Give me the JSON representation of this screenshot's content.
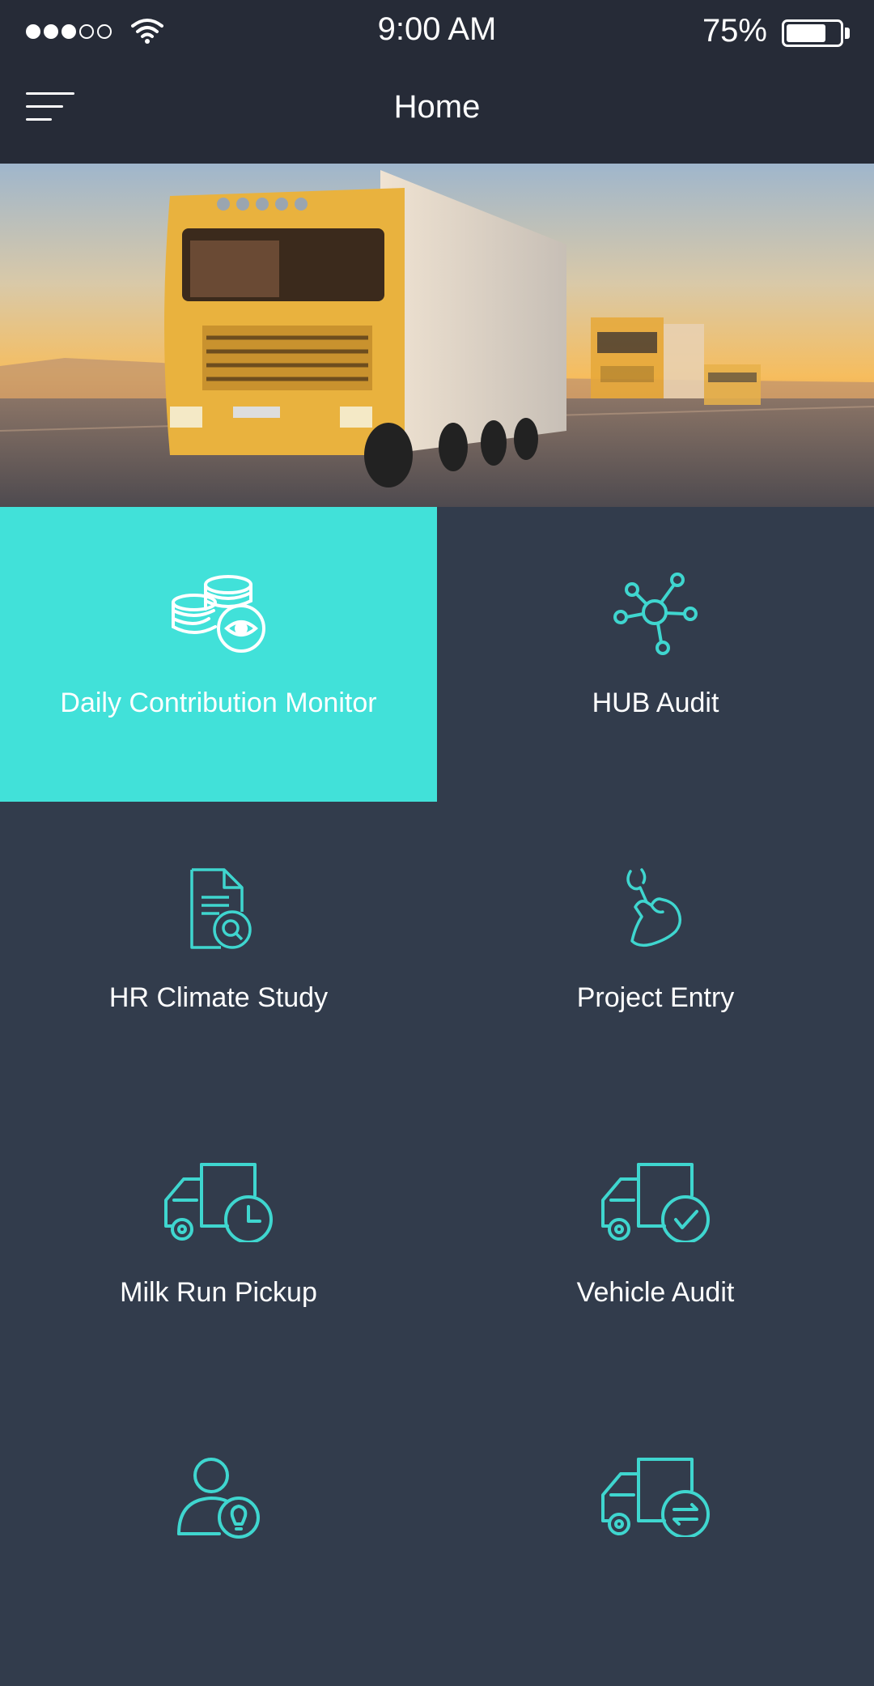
{
  "status_bar": {
    "time": "9:00 AM",
    "battery_percent": "75%",
    "battery_level": 0.75,
    "signal_bars_filled": 3,
    "signal_bars_total": 5
  },
  "header": {
    "title": "Home",
    "menu_icon": "hamburger-menu-icon"
  },
  "banner": {
    "image": "yellow-trucks-on-highway"
  },
  "colors": {
    "accent": "#41e1d9",
    "background": "#323c4c",
    "bar": "#262b37",
    "icon": "#3fd6cf"
  },
  "menu": {
    "items": [
      {
        "label": "Daily Contribution Monitor",
        "icon": "coins-eye-icon",
        "active": true
      },
      {
        "label": "HUB Audit",
        "icon": "network-hub-icon",
        "active": false
      },
      {
        "label": "HR Climate Study",
        "icon": "document-search-icon",
        "active": false
      },
      {
        "label": "Project Entry",
        "icon": "wrench-hand-icon",
        "active": false
      },
      {
        "label": "Milk Run Pickup",
        "icon": "truck-clock-icon",
        "active": false
      },
      {
        "label": "Vehicle Audit",
        "icon": "truck-check-icon",
        "active": false
      },
      {
        "label": "",
        "icon": "user-idea-icon",
        "active": false
      },
      {
        "label": "",
        "icon": "truck-transfer-icon",
        "active": false
      }
    ]
  }
}
